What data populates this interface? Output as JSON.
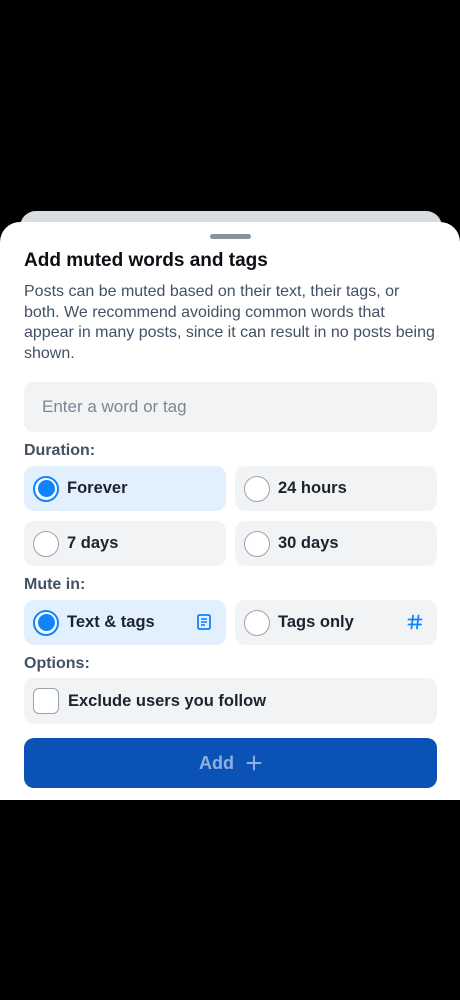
{
  "dialog": {
    "title": "Add muted words and tags",
    "description": "Posts can be muted based on their text, their tags, or both. We recommend avoiding common words that appear in many posts, since it can result in no posts being shown."
  },
  "input": {
    "placeholder": "Enter a word or tag",
    "value": ""
  },
  "duration": {
    "label": "Duration:",
    "options": [
      {
        "label": "Forever",
        "selected": true
      },
      {
        "label": "24 hours",
        "selected": false
      },
      {
        "label": "7 days",
        "selected": false
      },
      {
        "label": "30 days",
        "selected": false
      }
    ]
  },
  "mute_in": {
    "label": "Mute in:",
    "options": [
      {
        "label": "Text & tags",
        "selected": true,
        "icon": "document-icon"
      },
      {
        "label": "Tags only",
        "selected": false,
        "icon": "hashtag-icon"
      }
    ]
  },
  "options": {
    "label": "Options:",
    "exclude_following": {
      "label": "Exclude users you follow",
      "checked": false
    }
  },
  "add_button": {
    "label": "Add",
    "icon": "plus-icon"
  },
  "colors": {
    "accent": "#1083fe",
    "button": "#0a52b5",
    "selected_bg": "#e2f0fe"
  }
}
